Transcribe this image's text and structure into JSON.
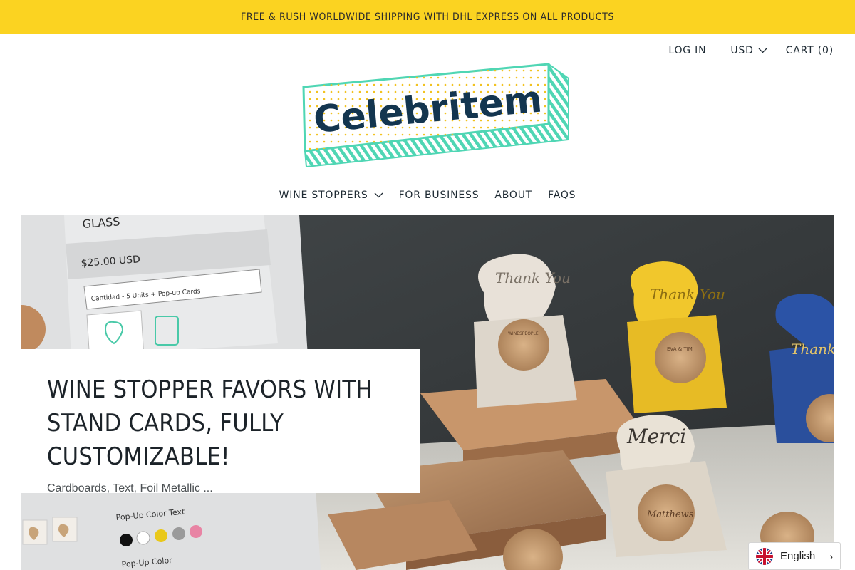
{
  "announcement": {
    "text": "FREE & RUSH WORLDWIDE SHIPPING WITH DHL EXPRESS ON ALL PRODUCTS"
  },
  "top_links": {
    "login": "LOG IN",
    "currency": "USD",
    "cart": "CART (0)"
  },
  "logo": {
    "text": "Celebritem"
  },
  "nav": {
    "items": [
      {
        "label": "WINE STOPPERS",
        "has_dropdown": true
      },
      {
        "label": "FOR BUSINESS"
      },
      {
        "label": "ABOUT"
      },
      {
        "label": "FAQS"
      }
    ]
  },
  "hero": {
    "title": "WINE STOPPER FAVORS WITH STAND CARDS, FULLY CUSTOMIZABLE!",
    "subtitle": "Cardboards, Text, Foil Metallic ...",
    "image_text": {
      "product_heading": "GLASS",
      "price": "$25.00 USD",
      "select_label": "Cantidad  -   5 Units + Pop-up Cards",
      "popup_color_text": "Pop-Up Color Text",
      "popup_color": "Pop-Up Color",
      "card1": "Thank You",
      "card2": "Thank You",
      "card3": "Thank You",
      "card4": "Merci",
      "stopper1": "WINESPEOPLE",
      "stopper2": "EVA & TIM",
      "stopper3": "Matthews"
    }
  },
  "language": {
    "label": "English",
    "flag": "uk-flag-icon"
  },
  "colors": {
    "accent_yellow": "#fbd321",
    "logo_teal": "#4fd6b4",
    "logo_navy": "#13354f"
  }
}
